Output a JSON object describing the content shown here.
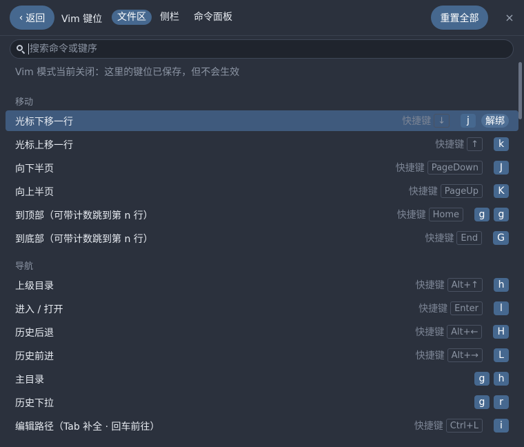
{
  "header": {
    "back_label": "返回",
    "title": "Vim 键位",
    "tabs": [
      {
        "label": "文件区",
        "active": true
      },
      {
        "label": "侧栏",
        "active": false
      },
      {
        "label": "命令面板",
        "active": false
      }
    ],
    "reset_label": "重置全部",
    "close_glyph": "×"
  },
  "search": {
    "placeholder": "搜索命令或键序",
    "value": ""
  },
  "notice": "Vim 模式当前关闭：这里的键位已保存，但不会生效",
  "shortcut_label": "快捷键",
  "unbind_label": "解绑",
  "sections": [
    {
      "label": "移动",
      "rows": [
        {
          "label": "光标下移一行",
          "shortcut": "↓",
          "keys": [
            "j"
          ],
          "selected": true
        },
        {
          "label": "光标上移一行",
          "shortcut": "↑",
          "keys": [
            "k"
          ],
          "selected": false
        },
        {
          "label": "向下半页",
          "shortcut": "PageDown",
          "keys": [
            "J"
          ],
          "selected": false
        },
        {
          "label": "向上半页",
          "shortcut": "PageUp",
          "keys": [
            "K"
          ],
          "selected": false
        },
        {
          "label": "到顶部（可带计数跳到第 n 行）",
          "shortcut": "Home",
          "keys": [
            "g",
            "g"
          ],
          "selected": false
        },
        {
          "label": "到底部（可带计数跳到第 n 行）",
          "shortcut": "End",
          "keys": [
            "G"
          ],
          "selected": false
        }
      ]
    },
    {
      "label": "导航",
      "rows": [
        {
          "label": "上级目录",
          "shortcut": "Alt+↑",
          "keys": [
            "h"
          ],
          "selected": false
        },
        {
          "label": "进入 / 打开",
          "shortcut": "Enter",
          "keys": [
            "l"
          ],
          "selected": false
        },
        {
          "label": "历史后退",
          "shortcut": "Alt+←",
          "keys": [
            "H"
          ],
          "selected": false
        },
        {
          "label": "历史前进",
          "shortcut": "Alt+→",
          "keys": [
            "L"
          ],
          "selected": false
        },
        {
          "label": "主目录",
          "shortcut": "",
          "keys": [
            "g",
            "h"
          ],
          "selected": false
        },
        {
          "label": "历史下拉",
          "shortcut": "",
          "keys": [
            "g",
            "r"
          ],
          "selected": false
        },
        {
          "label": "编辑路径（Tab 补全 · 回车前往）",
          "shortcut": "Ctrl+L",
          "keys": [
            "i"
          ],
          "selected": false
        }
      ]
    }
  ],
  "colors": {
    "background": "#2b313d",
    "accent": "#46688f",
    "selected_row": "#3f5a7d",
    "muted_text": "#8b94a3"
  }
}
